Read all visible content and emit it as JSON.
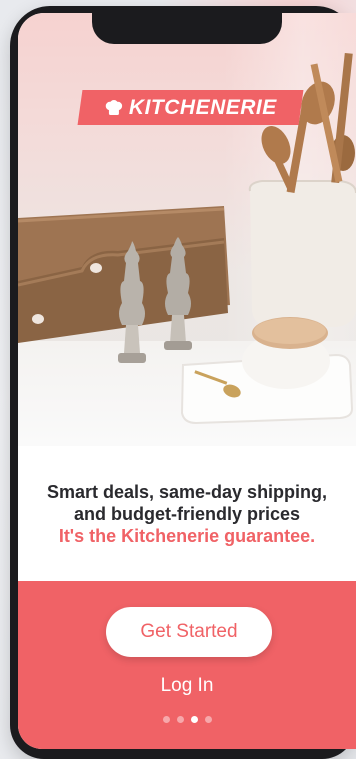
{
  "brand": {
    "logo_text": "KITCHENERIE",
    "logo_icon": "chef-hat-icon",
    "accent_color": "#f06266"
  },
  "tagline": {
    "line1": "Smart deals, same-day shipping,",
    "line2": "and budget-friendly prices",
    "line3": "It's the Kitchenerie guarantee."
  },
  "actions": {
    "get_started_label": "Get Started",
    "login_label": "Log In"
  },
  "pager": {
    "total": 4,
    "active_index": 2
  }
}
